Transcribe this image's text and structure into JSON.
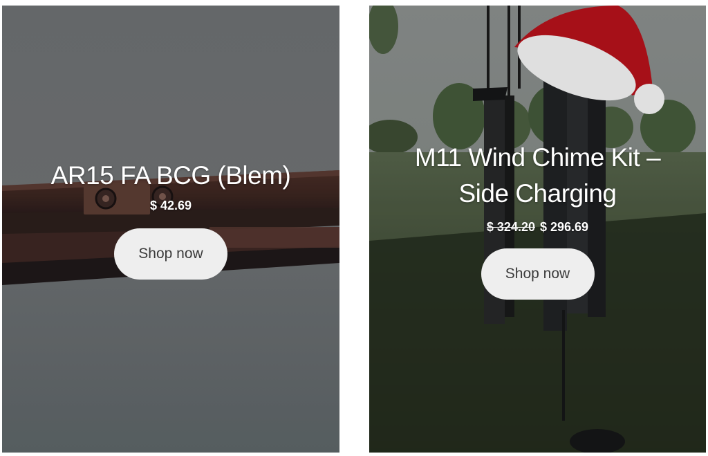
{
  "products": [
    {
      "title": "AR15 FA BCG (Blem)",
      "price": "$ 42.69",
      "cta_label": "Shop now"
    },
    {
      "title_line1": "M11 Wind Chime Kit –",
      "title_line2": "Side Charging",
      "compare_price": "$ 324.20",
      "price": "$ 296.69",
      "cta_label": "Shop now"
    }
  ],
  "colors": {
    "button_bg": "#eeeeee",
    "button_text": "#3a3a3a",
    "hat_red": "#b5121b",
    "overlay_text": "#ffffff"
  }
}
